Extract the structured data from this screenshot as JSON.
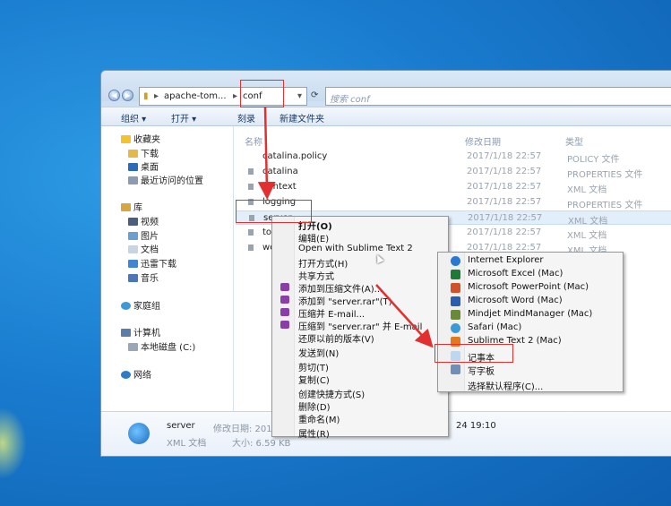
{
  "address_bar": {
    "segments": [
      "apache-tom...",
      "conf"
    ],
    "search_placeholder": "搜索 conf"
  },
  "toolbar": [
    "组织 ▾",
    "打开 ▾",
    "刻录",
    "新建文件夹"
  ],
  "nav_pane": {
    "favorites": [
      "收藏夹",
      "下载",
      "桌面",
      "最近访问的位置"
    ],
    "libraries": [
      "库",
      "视频",
      "图片",
      "文档",
      "迅雷下载",
      "音乐"
    ],
    "homegroup": "家庭组",
    "computer": [
      "计算机",
      "本地磁盘 (C:)"
    ],
    "network": "网络"
  },
  "columns": [
    "名称",
    "修改日期",
    "类型"
  ],
  "files": [
    {
      "name": "catalina.policy",
      "date": "2017/1/18 22:57",
      "type": "POLICY 文件"
    },
    {
      "name": "catalina",
      "date": "2017/1/18 22:57",
      "type": "PROPERTIES 文件"
    },
    {
      "name": "context",
      "date": "2017/1/18 22:57",
      "type": "XML 文档"
    },
    {
      "name": "logging",
      "date": "2017/1/18 22:57",
      "type": "PROPERTIES 文件"
    },
    {
      "name": "server",
      "date": "2017/1/18 22:57",
      "type": "XML 文档"
    },
    {
      "name": "tom",
      "date": "2017/1/18 22:57",
      "type": "XML 文档"
    },
    {
      "name": "web",
      "date": "2017/1/18 22:57",
      "type": "XML 文档"
    }
  ],
  "details": {
    "name": "server",
    "type": "XML 文档",
    "modified_label": "修改日期: 2017",
    "modified_tail": "24 19:10",
    "size": "大小: 6.59 KB"
  },
  "context_menu": [
    "打开(O)",
    "编辑(E)",
    "Open with Sublime Text 2",
    "打开方式(H)",
    "共享方式",
    "添加到压缩文件(A)...",
    "添加到 \"server.rar\"(T)",
    "压缩并 E-mail...",
    "压缩到 \"server.rar\" 并 E-mail",
    "还原以前的版本(V)",
    "发送到(N)",
    "剪切(T)",
    "复制(C)",
    "创建快捷方式(S)",
    "删除(D)",
    "重命名(M)",
    "属性(R)"
  ],
  "open_with_menu": [
    "Internet Explorer",
    "Microsoft Excel (Mac)",
    "Microsoft PowerPoint (Mac)",
    "Microsoft Word (Mac)",
    "Mindjet MindManager (Mac)",
    "Safari (Mac)",
    "Sublime Text 2 (Mac)",
    "记事本",
    "写字板",
    "选择默认程序(C)..."
  ],
  "colors": {
    "highlight_red": "#e23030",
    "menu_bg": "#f5f5f5",
    "selection": "#e3eefb"
  }
}
